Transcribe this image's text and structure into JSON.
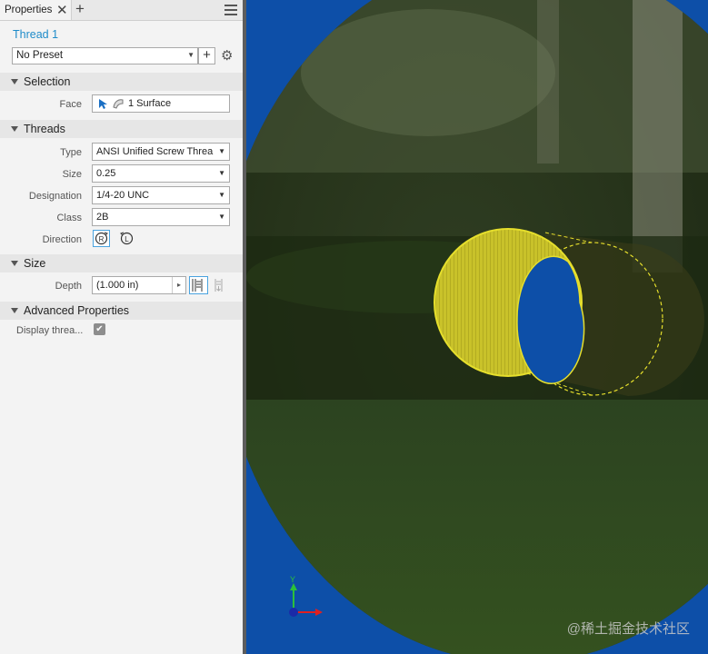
{
  "panel": {
    "tab_label": "Properties",
    "tab_close": "✕",
    "tab_add": "+",
    "feature_name": "Thread 1",
    "preset": {
      "value": "No Preset",
      "add_label": "+"
    },
    "sections": {
      "selection": "Selection",
      "threads": "Threads",
      "size": "Size",
      "advanced": "Advanced Properties"
    },
    "fields": {
      "face": {
        "label": "Face",
        "value": "1 Surface"
      },
      "type": {
        "label": "Type",
        "value": "ANSI Unified Screw Threa"
      },
      "size": {
        "label": "Size",
        "value": "0.25"
      },
      "designation": {
        "label": "Designation",
        "value": "1/4-20 UNC"
      },
      "class": {
        "label": "Class",
        "value": "2B"
      },
      "direction": {
        "label": "Direction"
      },
      "depth": {
        "label": "Depth",
        "value": "(1.000 in)"
      },
      "display_thread": {
        "label": "Display threa...",
        "checked": true
      }
    }
  },
  "viewport": {
    "axis_y": "Y",
    "watermark": "@稀土掘金技术社区",
    "highlight_color": "#e6df2c",
    "background_color": "#0d4fa8"
  },
  "icons": [
    "close-icon",
    "plus-icon",
    "hamburger-menu-icon",
    "gear-icon",
    "dropdown-arrow-icon",
    "select-pointer-icon",
    "surface-icon",
    "right-hand-thread-icon",
    "left-hand-thread-icon",
    "full-length-icon",
    "depth-icon",
    "checkmark-icon"
  ]
}
